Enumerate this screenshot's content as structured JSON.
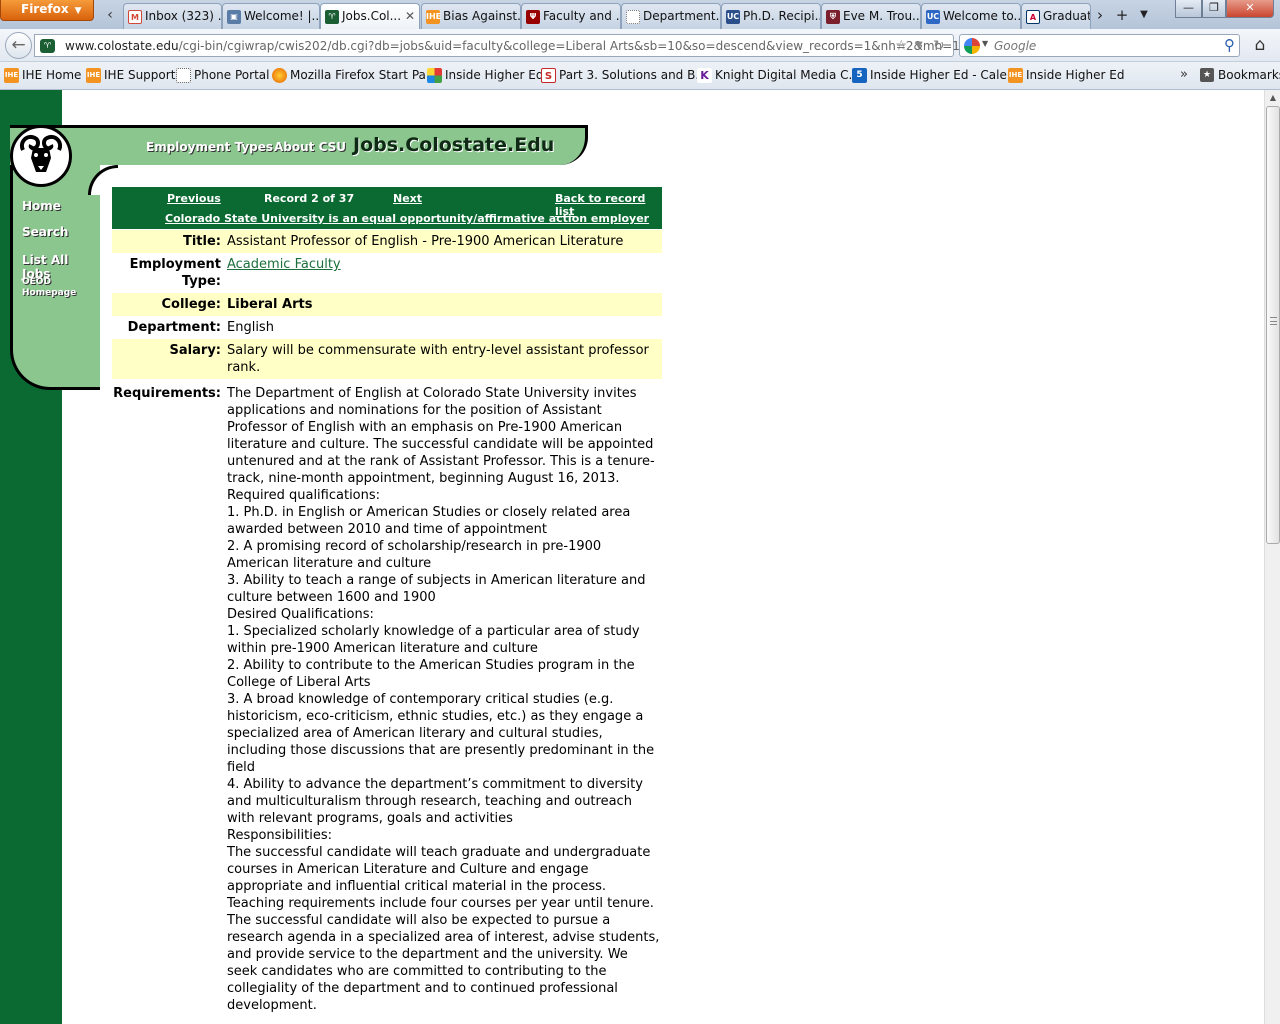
{
  "browser": {
    "menu_label": "Firefox",
    "tabs": [
      {
        "label": "Inbox (323) ...",
        "icon": "gmail-icon",
        "color": "#d14836"
      },
      {
        "label": "Welcome! |...",
        "icon": "page-icon",
        "color": "#5a7da8"
      },
      {
        "label": "Jobs.Col...",
        "icon": "ram-icon",
        "color": "#1c5e34",
        "active": true
      },
      {
        "label": "Bias Against...",
        "icon": "ihe-icon",
        "color": "#f39322"
      },
      {
        "label": "Faculty and ...",
        "icon": "iu-icon",
        "color": "#990000"
      },
      {
        "label": "Department...",
        "icon": "blank-page-icon",
        "color": "#ffffff"
      },
      {
        "label": "Ph.D. Recipi...",
        "icon": "uc-icon",
        "color": "#2b4f8a"
      },
      {
        "label": "Eve M. Trou...",
        "icon": "penn-icon",
        "color": "#7a1f2b"
      },
      {
        "label": "Welcome to...",
        "icon": "ucla-icon",
        "color": "#2d68c4"
      },
      {
        "label": "Graduat",
        "icon": "arizona-icon",
        "color": "#cc0033"
      }
    ],
    "url_domain": "www.colostate.edu",
    "url_path": "/cgi-bin/cgiwrap/cwis202/db.cgi?db=jobs&uid=faculty&college=Liberal Arts&sb=10&so=descend&view_records=1&nh=2&mh=1",
    "search_placeholder": "Google",
    "bookmarks": [
      {
        "label": "IHE Home",
        "icon": "ihe-icon"
      },
      {
        "label": "IHE Support",
        "icon": "ihe-icon"
      },
      {
        "label": "Phone Portal",
        "icon": "blank-page-icon"
      },
      {
        "label": "Mozilla Firefox Start Pa...",
        "icon": "firefox-icon"
      },
      {
        "label": "Inside Higher Ed",
        "icon": "puzzle-icon"
      },
      {
        "label": "Part 3. Solutions and B...",
        "icon": "s-icon"
      },
      {
        "label": "Knight Digital Media C...",
        "icon": "k-icon"
      },
      {
        "label": "Inside Higher Ed - Cale...",
        "icon": "calendar-icon"
      },
      {
        "label": "Inside Higher Ed",
        "icon": "ihe-icon"
      }
    ],
    "bookmarks_menu": "Bookmarks"
  },
  "site": {
    "title": "Jobs.Colostate.Edu",
    "nav_top": [
      "Employment Types",
      "About CSU"
    ],
    "nav_side": [
      "Home",
      "Search",
      "List All Jobs",
      "OEOD\nHomepage"
    ],
    "record_nav": {
      "previous": "Previous",
      "record_count": "Record 2 of 37",
      "next": "Next",
      "back": "Back to record list",
      "eoe": "Colorado State University is an equal opportunity/affirmative action employer"
    }
  },
  "job": {
    "title_label": "Title:",
    "title": "Assistant Professor of English - Pre-1900 American Literature",
    "employment_type_label": "Employment Type:",
    "employment_type": "Academic Faculty",
    "college_label": "College:",
    "college": "Liberal Arts",
    "department_label": "Department:",
    "department": "English",
    "salary_label": "Salary:",
    "salary": "Salary will be commensurate with entry-level assistant professor rank.",
    "requirements_label": "Requirements:",
    "requirements": [
      "The Department of English at Colorado State University invites applications and nominations for the position of Assistant Professor of English with an emphasis on Pre-1900 American literature and culture. The successful candidate will be appointed untenured and at the rank of Assistant Professor. This is a tenure-track, nine-month appointment, beginning August 16, 2013.",
      "Required qualifications:",
      "1. Ph.D. in English or American Studies or closely related area awarded between 2010 and time of appointment",
      "2. A promising record of scholarship/research in pre-1900 American literature and culture",
      "3. Ability to teach a range of subjects in American literature and culture between 1600 and 1900",
      "Desired Qualifications:",
      "1. Specialized scholarly knowledge of a particular area of study within pre-1900 American literature and culture",
      "2. Ability to contribute to the American Studies program in the College of Liberal Arts",
      "3. A broad knowledge of contemporary critical studies (e.g. historicism, eco-criticism, ethnic studies, etc.) as they engage a specialized area of American literary and cultural studies, including those discussions that are presently predominant in the field",
      "4. Ability to advance the department’s commitment to diversity and multiculturalism through research, teaching and outreach with relevant programs, goals and activities",
      "Responsibilities:",
      "The successful candidate will teach graduate and undergraduate courses in American Literature and Culture and engage appropriate and influential critical material in the process. Teaching requirements include four courses per year until tenure. The successful candidate will also be expected to pursue a research agenda in a specialized area of interest, advise students, and provide service to the department and the university. We seek candidates who are committed to contributing to the collegiality of the department and to continued professional development."
    ]
  },
  "colors": {
    "csu_green": "#0a6a32",
    "light_green": "#8cc68f",
    "row_highlight": "#ffffc6",
    "link": "#1a6f3a"
  }
}
